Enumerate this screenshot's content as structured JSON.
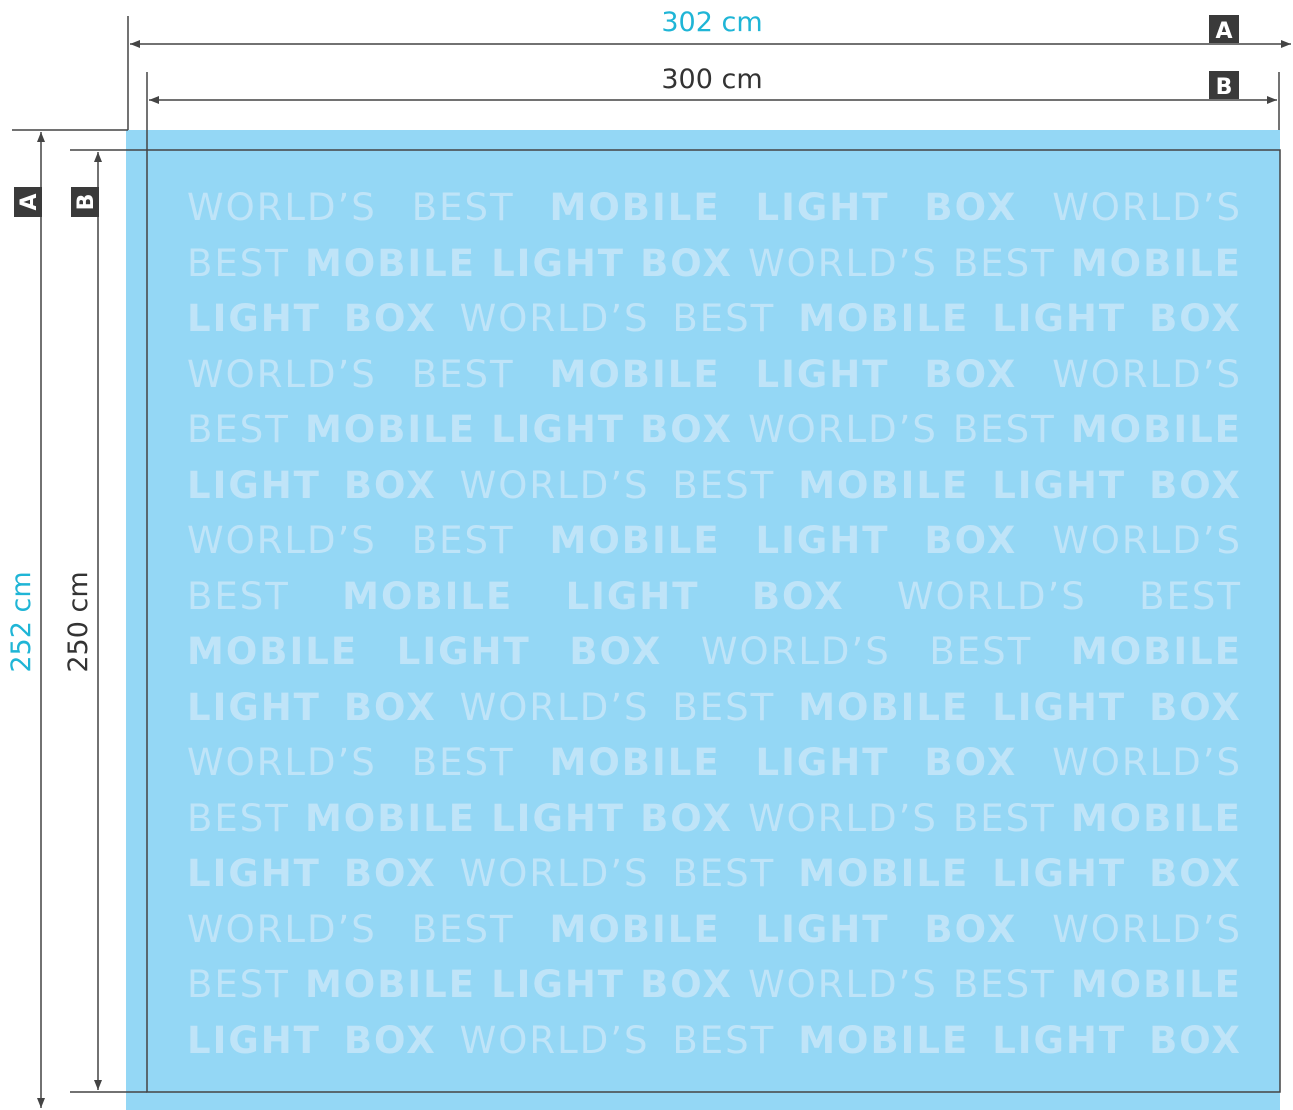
{
  "dimensions": {
    "outer_width": "302 cm",
    "inner_width": "300 cm",
    "outer_height": "252 cm",
    "inner_height": "250 cm"
  },
  "badges": {
    "outer": "A",
    "inner": "B"
  },
  "pattern_rows": [
    [
      [
        "t",
        "WORLD’S"
      ],
      [
        "t",
        "BEST"
      ],
      [
        "b",
        "MOBILE"
      ],
      [
        "b",
        "LIGHT"
      ],
      [
        "b",
        "BOX"
      ],
      [
        "t",
        "WORLD’S"
      ]
    ],
    [
      [
        "t",
        "BEST"
      ],
      [
        "b",
        "MOBILE"
      ],
      [
        "b",
        "LIGHT"
      ],
      [
        "b",
        "BOX"
      ],
      [
        "t",
        "WORLD’S"
      ],
      [
        "t",
        "BEST"
      ],
      [
        "b",
        "MOBILE"
      ]
    ],
    [
      [
        "b",
        "LIGHT"
      ],
      [
        "b",
        "BOX"
      ],
      [
        "t",
        "WORLD’S"
      ],
      [
        "t",
        "BEST"
      ],
      [
        "b",
        "MOBILE"
      ],
      [
        "b",
        "LIGHT"
      ],
      [
        "b",
        "BOX"
      ]
    ],
    [
      [
        "t",
        "WORLD’S"
      ],
      [
        "t",
        "BEST"
      ],
      [
        "b",
        "MOBILE"
      ],
      [
        "b",
        "LIGHT"
      ],
      [
        "b",
        "BOX"
      ],
      [
        "t",
        "WORLD’S"
      ]
    ],
    [
      [
        "t",
        "BEST"
      ],
      [
        "b",
        "MOBILE"
      ],
      [
        "b",
        "LIGHT"
      ],
      [
        "b",
        "BOX"
      ],
      [
        "t",
        "WORLD’S"
      ],
      [
        "t",
        "BEST"
      ],
      [
        "b",
        "MOBILE"
      ]
    ],
    [
      [
        "b",
        "LIGHT"
      ],
      [
        "b",
        "BOX"
      ],
      [
        "t",
        "WORLD’S"
      ],
      [
        "t",
        "BEST"
      ],
      [
        "b",
        "MOBILE"
      ],
      [
        "b",
        "LIGHT"
      ],
      [
        "b",
        "BOX"
      ]
    ],
    [
      [
        "t",
        "WORLD’S"
      ],
      [
        "t",
        "BEST"
      ],
      [
        "b",
        "MOBILE"
      ],
      [
        "b",
        "LIGHT"
      ],
      [
        "b",
        "BOX"
      ],
      [
        "t",
        "WORLD’S"
      ]
    ],
    [
      [
        "t",
        "BEST"
      ],
      [
        "b",
        "MOBILE"
      ],
      [
        "b",
        "LIGHT"
      ],
      [
        "b",
        "BOX"
      ],
      [
        "t",
        "WORLD’S"
      ],
      [
        "t",
        "BEST"
      ]
    ],
    [
      [
        "b",
        "MOBILE"
      ],
      [
        "b",
        "LIGHT"
      ],
      [
        "b",
        "BOX"
      ],
      [
        "t",
        "WORLD’S"
      ],
      [
        "t",
        "BEST"
      ],
      [
        "b",
        "MOBILE"
      ]
    ],
    [
      [
        "b",
        "LIGHT"
      ],
      [
        "b",
        "BOX"
      ],
      [
        "t",
        "WORLD’S"
      ],
      [
        "t",
        "BEST"
      ],
      [
        "b",
        "MOBILE"
      ],
      [
        "b",
        "LIGHT"
      ],
      [
        "b",
        "BOX"
      ]
    ],
    [
      [
        "t",
        "WORLD’S"
      ],
      [
        "t",
        "BEST"
      ],
      [
        "b",
        "MOBILE"
      ],
      [
        "b",
        "LIGHT"
      ],
      [
        "b",
        "BOX"
      ],
      [
        "t",
        "WORLD’S"
      ]
    ],
    [
      [
        "t",
        "BEST"
      ],
      [
        "b",
        "MOBILE"
      ],
      [
        "b",
        "LIGHT"
      ],
      [
        "b",
        "BOX"
      ],
      [
        "t",
        "WORLD’S"
      ],
      [
        "t",
        "BEST"
      ],
      [
        "b",
        "MOBILE"
      ]
    ],
    [
      [
        "b",
        "LIGHT"
      ],
      [
        "b",
        "BOX"
      ],
      [
        "t",
        "WORLD’S"
      ],
      [
        "t",
        "BEST"
      ],
      [
        "b",
        "MOBILE"
      ],
      [
        "b",
        "LIGHT"
      ],
      [
        "b",
        "BOX"
      ]
    ],
    [
      [
        "t",
        "WORLD’S"
      ],
      [
        "t",
        "BEST"
      ],
      [
        "b",
        "MOBILE"
      ],
      [
        "b",
        "LIGHT"
      ],
      [
        "b",
        "BOX"
      ],
      [
        "t",
        "WORLD’S"
      ]
    ],
    [
      [
        "t",
        "BEST"
      ],
      [
        "b",
        "MOBILE"
      ],
      [
        "b",
        "LIGHT"
      ],
      [
        "b",
        "BOX"
      ],
      [
        "t",
        "WORLD’S"
      ],
      [
        "t",
        "BEST"
      ],
      [
        "b",
        "MOBILE"
      ]
    ],
    [
      [
        "b",
        "LIGHT"
      ],
      [
        "b",
        "BOX"
      ],
      [
        "t",
        "WORLD’S"
      ],
      [
        "t",
        "BEST"
      ],
      [
        "b",
        "MOBILE"
      ],
      [
        "b",
        "LIGHT"
      ],
      [
        "b",
        "BOX"
      ]
    ]
  ],
  "colors": {
    "panel_fill": "#94d7f5",
    "pattern_text": "#c3e6f9",
    "accent_text": "#1fb5d6",
    "dark_text": "#333333",
    "line": "#444444",
    "badge_fill": "#3a3a3a",
    "badge_text": "#ffffff"
  }
}
